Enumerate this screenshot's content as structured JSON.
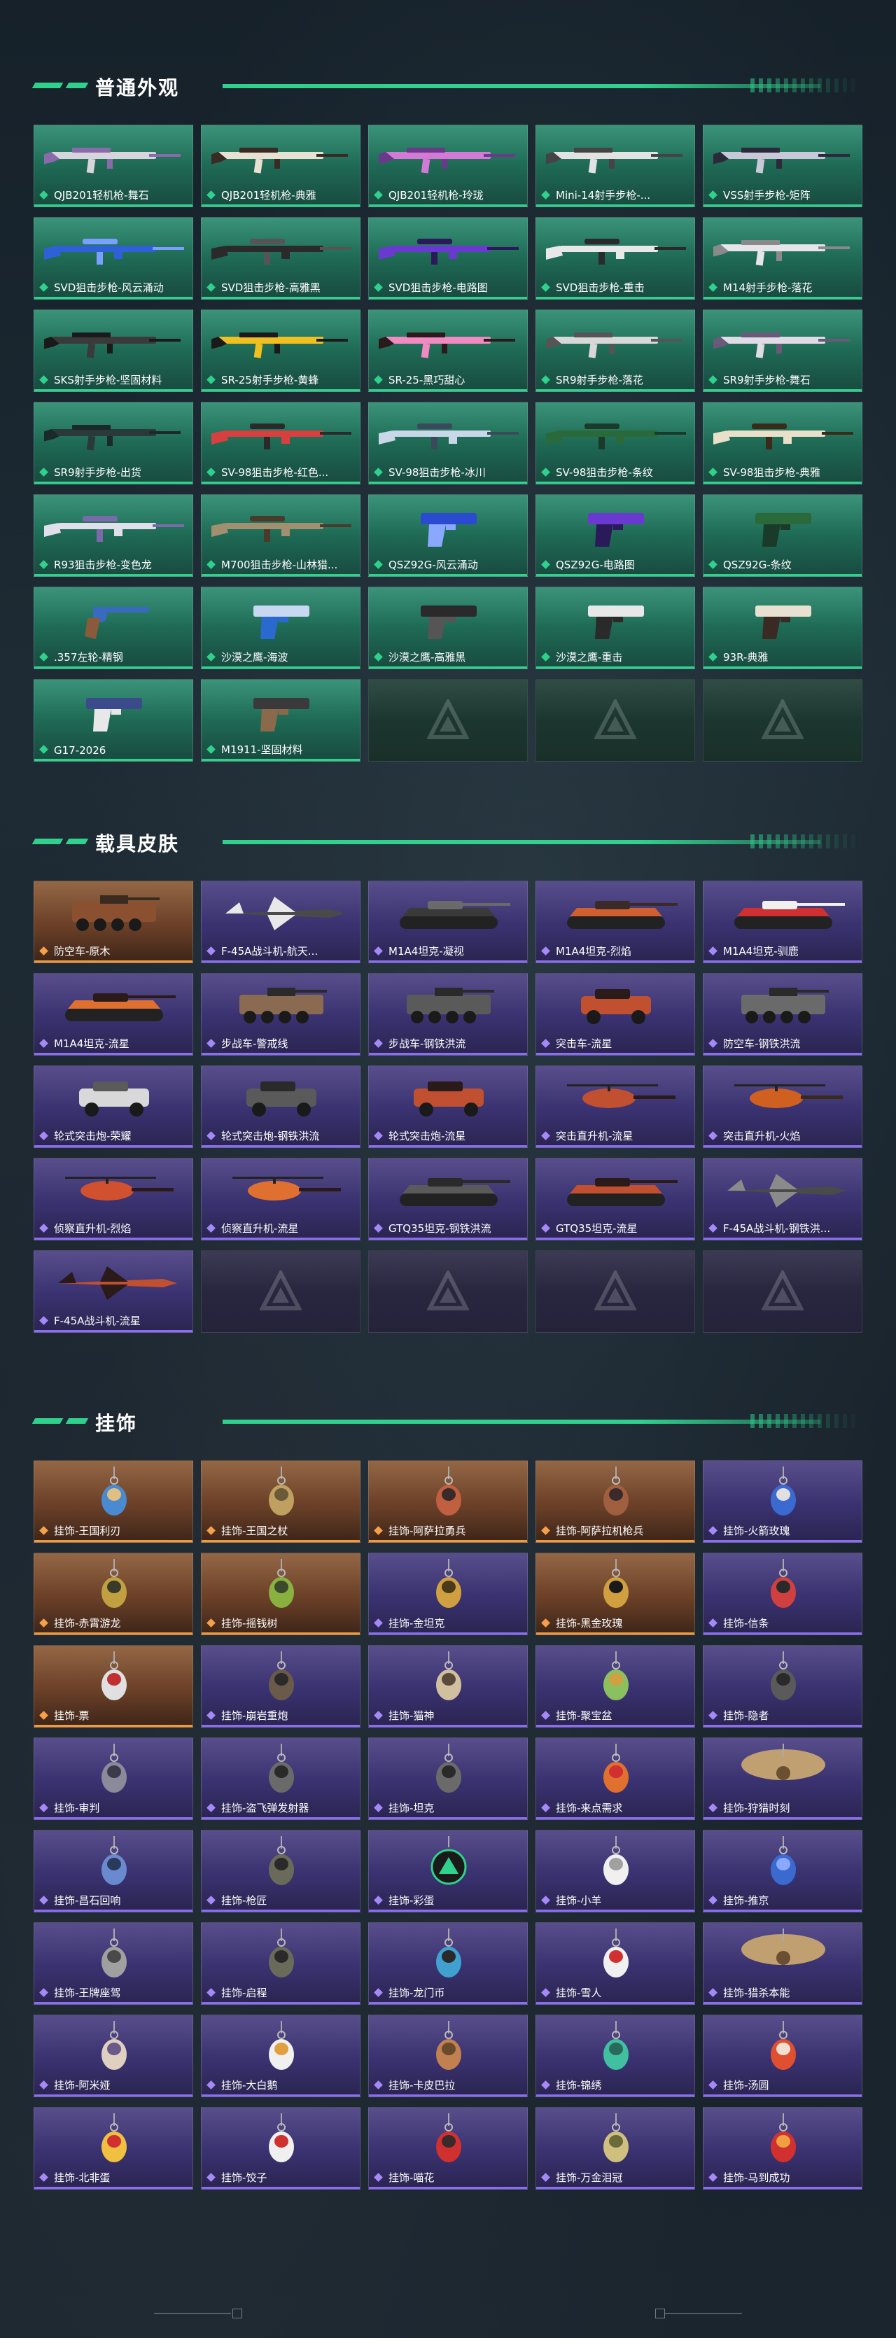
{
  "sections": [
    {
      "title": "普通外观",
      "style": "green",
      "items": [
        {
          "label": "QJB201轻机枪-舞石",
          "art": "rifle",
          "c1": "#d8d4dc",
          "c2": "#8a6aa8"
        },
        {
          "label": "QJB201轻机枪-典雅",
          "art": "rifle",
          "c1": "#e8e0d0",
          "c2": "#3a2a24"
        },
        {
          "label": "QJB201轻机枪-玲珑",
          "art": "rifle",
          "c1": "#d47ad6",
          "c2": "#6a3a8a"
        },
        {
          "label": "Mini-14射手步枪-...",
          "art": "rifle",
          "c1": "#e2e2e2",
          "c2": "#444"
        },
        {
          "label": "VSS射手步枪-矩阵",
          "art": "rifle",
          "c1": "#c8c8d8",
          "c2": "#2a2a3a"
        },
        {
          "label": "SVD狙击步枪-风云涌动",
          "art": "sniper",
          "c1": "#3060d8",
          "c2": "#7aa0ff"
        },
        {
          "label": "SVD狙击步枪-高雅黑",
          "art": "sniper",
          "c1": "#2a2a2a",
          "c2": "#555"
        },
        {
          "label": "SVD狙击步枪-电路图",
          "art": "sniper",
          "c1": "#6a3ad0",
          "c2": "#2a1a5a"
        },
        {
          "label": "SVD狙击步枪-重击",
          "art": "sniper",
          "c1": "#e8e8e8",
          "c2": "#2a2a2a"
        },
        {
          "label": "M14射手步枪-落花",
          "art": "rifle",
          "c1": "#e6e6ea",
          "c2": "#8a8a8a"
        },
        {
          "label": "SKS射手步枪-坚固材料",
          "art": "rifle",
          "c1": "#3a3a3a",
          "c2": "#1a1a1a"
        },
        {
          "label": "SR-25射手步枪-黄蜂",
          "art": "rifle",
          "c1": "#f0c020",
          "c2": "#1a1a1a"
        },
        {
          "label": "SR-25-黑巧甜心",
          "art": "rifle",
          "c1": "#f08ac0",
          "c2": "#2a1a1a"
        },
        {
          "label": "SR9射手步枪-落花",
          "art": "rifle",
          "c1": "#d8d8d8",
          "c2": "#555"
        },
        {
          "label": "SR9射手步枪-舞石",
          "art": "rifle",
          "c1": "#e0dce6",
          "c2": "#6a5a7a"
        },
        {
          "label": "SR9射手步枪-出货",
          "art": "rifle",
          "c1": "#2a3a3a",
          "c2": "#1a2a2a"
        },
        {
          "label": "SV-98狙击步枪-红色...",
          "art": "sniper",
          "c1": "#d84040",
          "c2": "#2a2a2a"
        },
        {
          "label": "SV-98狙击步枪-冰川",
          "art": "sniper",
          "c1": "#c8d8e8",
          "c2": "#3a4a5a"
        },
        {
          "label": "SV-98狙击步枪-条纹",
          "art": "sniper",
          "c1": "#2a6a3a",
          "c2": "#1a3a2a"
        },
        {
          "label": "SV-98狙击步枪-典雅",
          "art": "sniper",
          "c1": "#e8e0c8",
          "c2": "#3a2a1a"
        },
        {
          "label": "R93狙击步枪-变色龙",
          "art": "sniper",
          "c1": "#e0e0ea",
          "c2": "#7a6aaa"
        },
        {
          "label": "M700狙击步枪-山林猎...",
          "art": "sniper",
          "c1": "#a09070",
          "c2": "#4a3a2a"
        },
        {
          "label": "QSZ92G-风云涌动",
          "art": "pistol",
          "c1": "#2a4ad0",
          "c2": "#8aa8ff"
        },
        {
          "label": "QSZ92G-电路图",
          "art": "pistol",
          "c1": "#6a3ad0",
          "c2": "#2a1a5a"
        },
        {
          "label": "QSZ92G-条纹",
          "art": "pistol",
          "c1": "#2a6a3a",
          "c2": "#1a3a2a"
        },
        {
          "label": ".357左轮-精钢",
          "art": "revolver",
          "c1": "#3a6ac0",
          "c2": "#8a5a3a"
        },
        {
          "label": "沙漠之鹰-海波",
          "art": "pistol",
          "c1": "#c8d8f0",
          "c2": "#2a6ad0"
        },
        {
          "label": "沙漠之鹰-高雅黑",
          "art": "pistol",
          "c1": "#2a2a2a",
          "c2": "#555"
        },
        {
          "label": "沙漠之鹰-重击",
          "art": "pistol",
          "c1": "#e8e8e8",
          "c2": "#2a2a2a"
        },
        {
          "label": "93R-典雅",
          "art": "pistol",
          "c1": "#e8e0d0",
          "c2": "#3a2a24"
        },
        {
          "label": "G17-2026",
          "art": "pistol",
          "c1": "#3a4a8a",
          "c2": "#e8e8e8"
        },
        {
          "label": "M1911-坚固材料",
          "art": "pistol",
          "c1": "#3a3a3a",
          "c2": "#8a6a4a"
        },
        {
          "label": "",
          "art": "empty"
        },
        {
          "label": "",
          "art": "empty"
        },
        {
          "label": "",
          "art": "empty"
        }
      ]
    },
    {
      "title": "载具皮肤",
      "style": "purple",
      "items": [
        {
          "label": "防空车-原木",
          "art": "apc",
          "c1": "#8a5030",
          "c2": "#3a2a20",
          "tone": "orange"
        },
        {
          "label": "F-45A战斗机-航天...",
          "art": "jet",
          "c1": "#4a4a4a",
          "c2": "#e8e8e8",
          "tone": "purple"
        },
        {
          "label": "M1A4坦克-凝视",
          "art": "tank",
          "c1": "#3a3a3a",
          "c2": "#6a6a6a",
          "tone": "purple"
        },
        {
          "label": "M1A4坦克-烈焰",
          "art": "tank",
          "c1": "#d06030",
          "c2": "#3a2a2a",
          "tone": "purple"
        },
        {
          "label": "M1A4坦克-驯鹿",
          "art": "tank",
          "c1": "#d03030",
          "c2": "#f0f0f0",
          "tone": "purple"
        },
        {
          "label": "M1A4坦克-流星",
          "art": "tank",
          "c1": "#e07030",
          "c2": "#2a1a1a",
          "tone": "purple"
        },
        {
          "label": "步战车-警戒线",
          "art": "apc",
          "c1": "#8a6a50",
          "c2": "#2a2a2a",
          "tone": "purple"
        },
        {
          "label": "步战车-钢铁洪流",
          "art": "apc",
          "c1": "#5a5a5a",
          "c2": "#2a2a2a",
          "tone": "purple"
        },
        {
          "label": "突击车-流星",
          "art": "truck",
          "c1": "#c05030",
          "c2": "#2a1a1a",
          "tone": "purple"
        },
        {
          "label": "防空车-钢铁洪流",
          "art": "apc",
          "c1": "#6a6a6a",
          "c2": "#2a2a2a",
          "tone": "purple"
        },
        {
          "label": "轮式突击炮-荣耀",
          "art": "car",
          "c1": "#d8d8d8",
          "c2": "#5a5a5a",
          "tone": "purple"
        },
        {
          "label": "轮式突击炮-钢铁洪流",
          "art": "car",
          "c1": "#5a5a5a",
          "c2": "#2a2a2a",
          "tone": "purple"
        },
        {
          "label": "轮式突击炮-流星",
          "art": "car",
          "c1": "#c05030",
          "c2": "#2a1a1a",
          "tone": "purple"
        },
        {
          "label": "突击直升机-流星",
          "art": "heli",
          "c1": "#c05030",
          "c2": "#2a1a1a",
          "tone": "purple"
        },
        {
          "label": "突击直升机-火焰",
          "art": "heli",
          "c1": "#d06020",
          "c2": "#3a2a1a",
          "tone": "purple"
        },
        {
          "label": "侦察直升机-烈焰",
          "art": "heli",
          "c1": "#d05030",
          "c2": "#2a1a1a",
          "tone": "purple"
        },
        {
          "label": "侦察直升机-流星",
          "art": "heli",
          "c1": "#e07030",
          "c2": "#2a1a1a",
          "tone": "purple"
        },
        {
          "label": "GTQ35坦克-钢铁洪流",
          "art": "tank",
          "c1": "#5a5a5a",
          "c2": "#2a2a2a",
          "tone": "purple"
        },
        {
          "label": "GTQ35坦克-流星",
          "art": "tank",
          "c1": "#c05030",
          "c2": "#2a1a1a",
          "tone": "purple"
        },
        {
          "label": "F-45A战斗机-钢铁洪...",
          "art": "jet",
          "c1": "#4a4a4a",
          "c2": "#8a8a8a",
          "tone": "purple"
        },
        {
          "label": "F-45A战斗机-流星",
          "art": "jet",
          "c1": "#c05030",
          "c2": "#2a1a1a",
          "tone": "purple"
        },
        {
          "label": "",
          "art": "empty"
        },
        {
          "label": "",
          "art": "empty"
        },
        {
          "label": "",
          "art": "empty"
        },
        {
          "label": "",
          "art": "empty"
        }
      ]
    },
    {
      "title": "挂饰",
      "style": "purple",
      "items": [
        {
          "label": "挂饰-王国利刃",
          "art": "charm",
          "c1": "#4a8ad0",
          "c2": "#e0c080",
          "tone": "orange"
        },
        {
          "label": "挂饰-王国之杖",
          "art": "charm",
          "c1": "#c0a060",
          "c2": "#6a5a3a",
          "tone": "orange"
        },
        {
          "label": "挂饰-阿萨拉勇兵",
          "art": "charm",
          "c1": "#c06040",
          "c2": "#3a2a2a",
          "tone": "orange"
        },
        {
          "label": "挂饰-阿萨拉机枪兵",
          "art": "charm",
          "c1": "#a06040",
          "c2": "#3a2a2a",
          "tone": "orange"
        },
        {
          "label": "挂饰-火箭玫瑰",
          "art": "charm",
          "c1": "#3a6ad0",
          "c2": "#e0e0e0",
          "tone": "purple"
        },
        {
          "label": "挂饰-赤霄游龙",
          "art": "charm",
          "c1": "#c0a040",
          "c2": "#3a3a2a",
          "tone": "orange"
        },
        {
          "label": "挂饰-摇钱树",
          "art": "charm",
          "c1": "#8ab040",
          "c2": "#3a4a2a",
          "tone": "orange"
        },
        {
          "label": "挂饰-金坦克",
          "art": "charm",
          "c1": "#d0a040",
          "c2": "#4a3a1a",
          "tone": "purple"
        },
        {
          "label": "挂饰-黑金玫瑰",
          "art": "charm",
          "c1": "#d0a040",
          "c2": "#1a1a1a",
          "tone": "orange"
        },
        {
          "label": "挂饰-信条",
          "art": "charm",
          "c1": "#d04040",
          "c2": "#2a2a2a",
          "tone": "purple"
        },
        {
          "label": "挂饰-票",
          "art": "charm",
          "c1": "#e0e0e0",
          "c2": "#c03030",
          "tone": "orange"
        },
        {
          "label": "挂饰-崩岩重炮",
          "art": "charm",
          "c1": "#6a5a4a",
          "c2": "#2a2a2a",
          "tone": "purple"
        },
        {
          "label": "挂饰-猫神",
          "art": "charm",
          "c1": "#d0c0a0",
          "c2": "#5a4a3a",
          "tone": "purple"
        },
        {
          "label": "挂饰-聚宝盆",
          "art": "charm",
          "c1": "#8ac060",
          "c2": "#d0a040",
          "tone": "purple"
        },
        {
          "label": "挂饰-隐者",
          "art": "charm",
          "c1": "#5a5a5a",
          "c2": "#2a2a2a",
          "tone": "purple"
        },
        {
          "label": "挂饰-审判",
          "art": "charm",
          "c1": "#8a8a9a",
          "c2": "#3a3a4a",
          "tone": "purple"
        },
        {
          "label": "挂饰-盗飞弹发射器",
          "art": "charm",
          "c1": "#6a6a6a",
          "c2": "#2a2a2a",
          "tone": "purple"
        },
        {
          "label": "挂饰-坦克",
          "art": "charm",
          "c1": "#6a6a6a",
          "c2": "#2a2a2a",
          "tone": "purple"
        },
        {
          "label": "挂饰-来点需求",
          "art": "charm",
          "c1": "#e07030",
          "c2": "#d03030",
          "tone": "purple"
        },
        {
          "label": "挂饰-狩猎时刻",
          "art": "antler",
          "c1": "#c0a070",
          "c2": "#6a5030",
          "tone": "purple"
        },
        {
          "label": "挂饰-昌石回响",
          "art": "charm",
          "c1": "#6a8ad0",
          "c2": "#2a3a5a",
          "tone": "purple"
        },
        {
          "label": "挂饰-枪匠",
          "art": "charm",
          "c1": "#6a6a5a",
          "c2": "#2a2a2a",
          "tone": "purple"
        },
        {
          "label": "挂饰-彩蛋",
          "art": "triangle",
          "c1": "#2fd18c",
          "c2": "#1a1a1a",
          "tone": "purple"
        },
        {
          "label": "挂饰-小羊",
          "art": "charm",
          "c1": "#f0f0f0",
          "c2": "#a0a0a0",
          "tone": "purple"
        },
        {
          "label": "挂饰-推京",
          "art": "charm",
          "c1": "#3a6ad0",
          "c2": "#8aa8ff",
          "tone": "purple"
        },
        {
          "label": "挂饰-王牌座驾",
          "art": "charm",
          "c1": "#a0a0a0",
          "c2": "#4a4a4a",
          "tone": "purple"
        },
        {
          "label": "挂饰-启程",
          "art": "charm",
          "c1": "#6a6a5a",
          "c2": "#2a2a2a",
          "tone": "purple"
        },
        {
          "label": "挂饰-龙门币",
          "art": "charm",
          "c1": "#40a0d0",
          "c2": "#2a2a2a",
          "tone": "purple"
        },
        {
          "label": "挂饰-雪人",
          "art": "charm",
          "c1": "#f0f0f0",
          "c2": "#d03030",
          "tone": "purple"
        },
        {
          "label": "挂饰-猎杀本能",
          "art": "antler",
          "c1": "#c0a070",
          "c2": "#6a5030",
          "tone": "purple"
        },
        {
          "label": "挂饰-阿米娅",
          "art": "charm",
          "c1": "#e0d0c0",
          "c2": "#6a5a8a",
          "tone": "purple"
        },
        {
          "label": "挂饰-大白鹅",
          "art": "charm",
          "c1": "#f0f0f0",
          "c2": "#e0a040",
          "tone": "purple"
        },
        {
          "label": "挂饰-卡皮巴拉",
          "art": "charm",
          "c1": "#c08050",
          "c2": "#6a4a2a",
          "tone": "purple"
        },
        {
          "label": "挂饰-锦绣",
          "art": "charm",
          "c1": "#40c0a0",
          "c2": "#2a6a5a",
          "tone": "purple"
        },
        {
          "label": "挂饰-汤圆",
          "art": "charm",
          "c1": "#e05030",
          "c2": "#f0e0d0",
          "tone": "purple"
        },
        {
          "label": "挂饰-北非蛋",
          "art": "charm",
          "c1": "#f0c040",
          "c2": "#d03030",
          "tone": "purple"
        },
        {
          "label": "挂饰-饺子",
          "art": "charm",
          "c1": "#f0f0f0",
          "c2": "#d03030",
          "tone": "purple"
        },
        {
          "label": "挂饰-喵花",
          "art": "charm",
          "c1": "#d03030",
          "c2": "#3a2a2a",
          "tone": "purple"
        },
        {
          "label": "挂饰-万金泪冠",
          "art": "charm",
          "c1": "#d0c080",
          "c2": "#6a6a3a",
          "tone": "purple"
        },
        {
          "label": "挂饰-马到成功",
          "art": "charm",
          "c1": "#d03030",
          "c2": "#f0a040",
          "tone": "purple"
        }
      ]
    }
  ]
}
